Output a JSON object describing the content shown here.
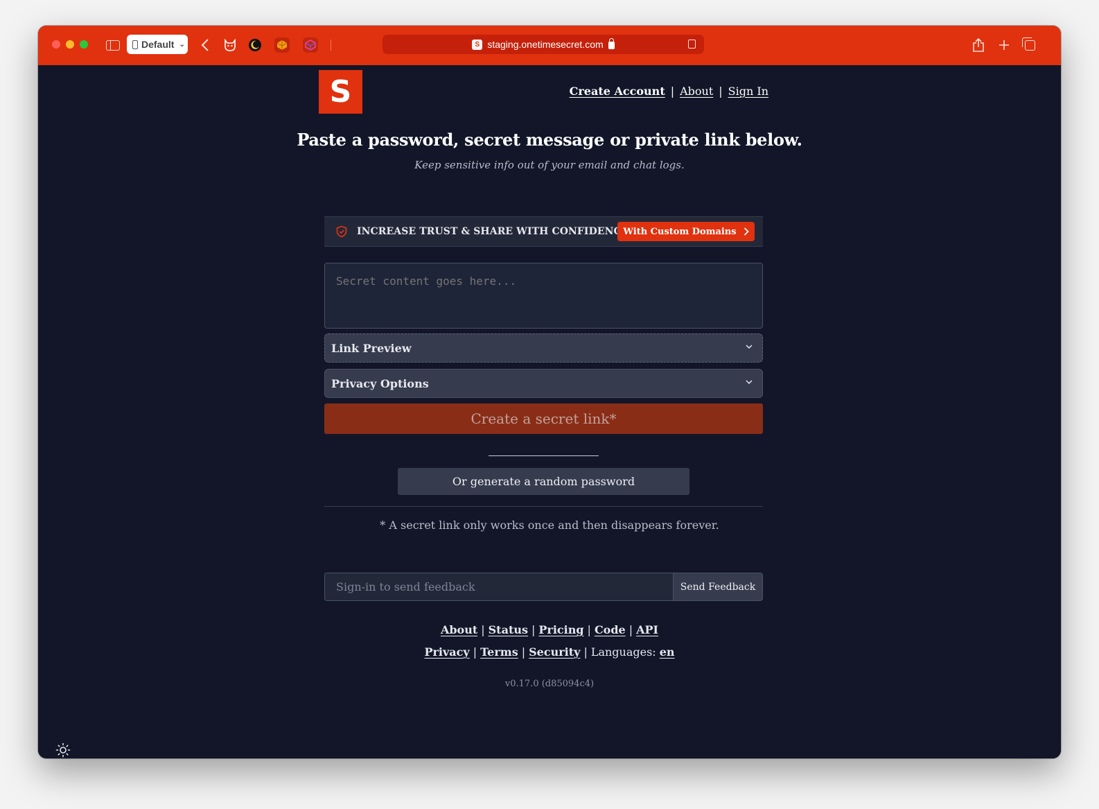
{
  "browser": {
    "profile_label": "Default",
    "url": "staging.onetimesecret.com",
    "favicon_letter": "S"
  },
  "header": {
    "logo_letter": "S",
    "nav": {
      "create_account": "Create Account",
      "about": "About",
      "sign_in": "Sign In",
      "separator": "|"
    }
  },
  "hero": {
    "title": "Paste a password, secret message or private link below.",
    "subtitle": "Keep sensitive info out of your email and chat logs."
  },
  "banner": {
    "text": "INCREASE TRUST & SHARE WITH CONFIDENCE",
    "button_label": "With Custom Domains"
  },
  "form": {
    "secret_placeholder": "Secret content goes here...",
    "link_preview_label": "Link Preview",
    "privacy_options_label": "Privacy Options",
    "create_button_label": "Create a secret link*",
    "generate_button_label": "Or generate a random password",
    "footnote": "* A secret link only works once and then disappears forever."
  },
  "feedback": {
    "placeholder": "Sign-in to send feedback",
    "button_label": "Send Feedback"
  },
  "footer": {
    "row1": [
      "About",
      "Status",
      "Pricing",
      "Code",
      "API"
    ],
    "row2": [
      "Privacy",
      "Terms",
      "Security"
    ],
    "languages_label": "Languages:",
    "language": "en",
    "version": "v0.17.0 (d85094c4)"
  },
  "colors": {
    "brand": "#e0320f",
    "background": "#121628",
    "create_button": "#8a2d17"
  }
}
